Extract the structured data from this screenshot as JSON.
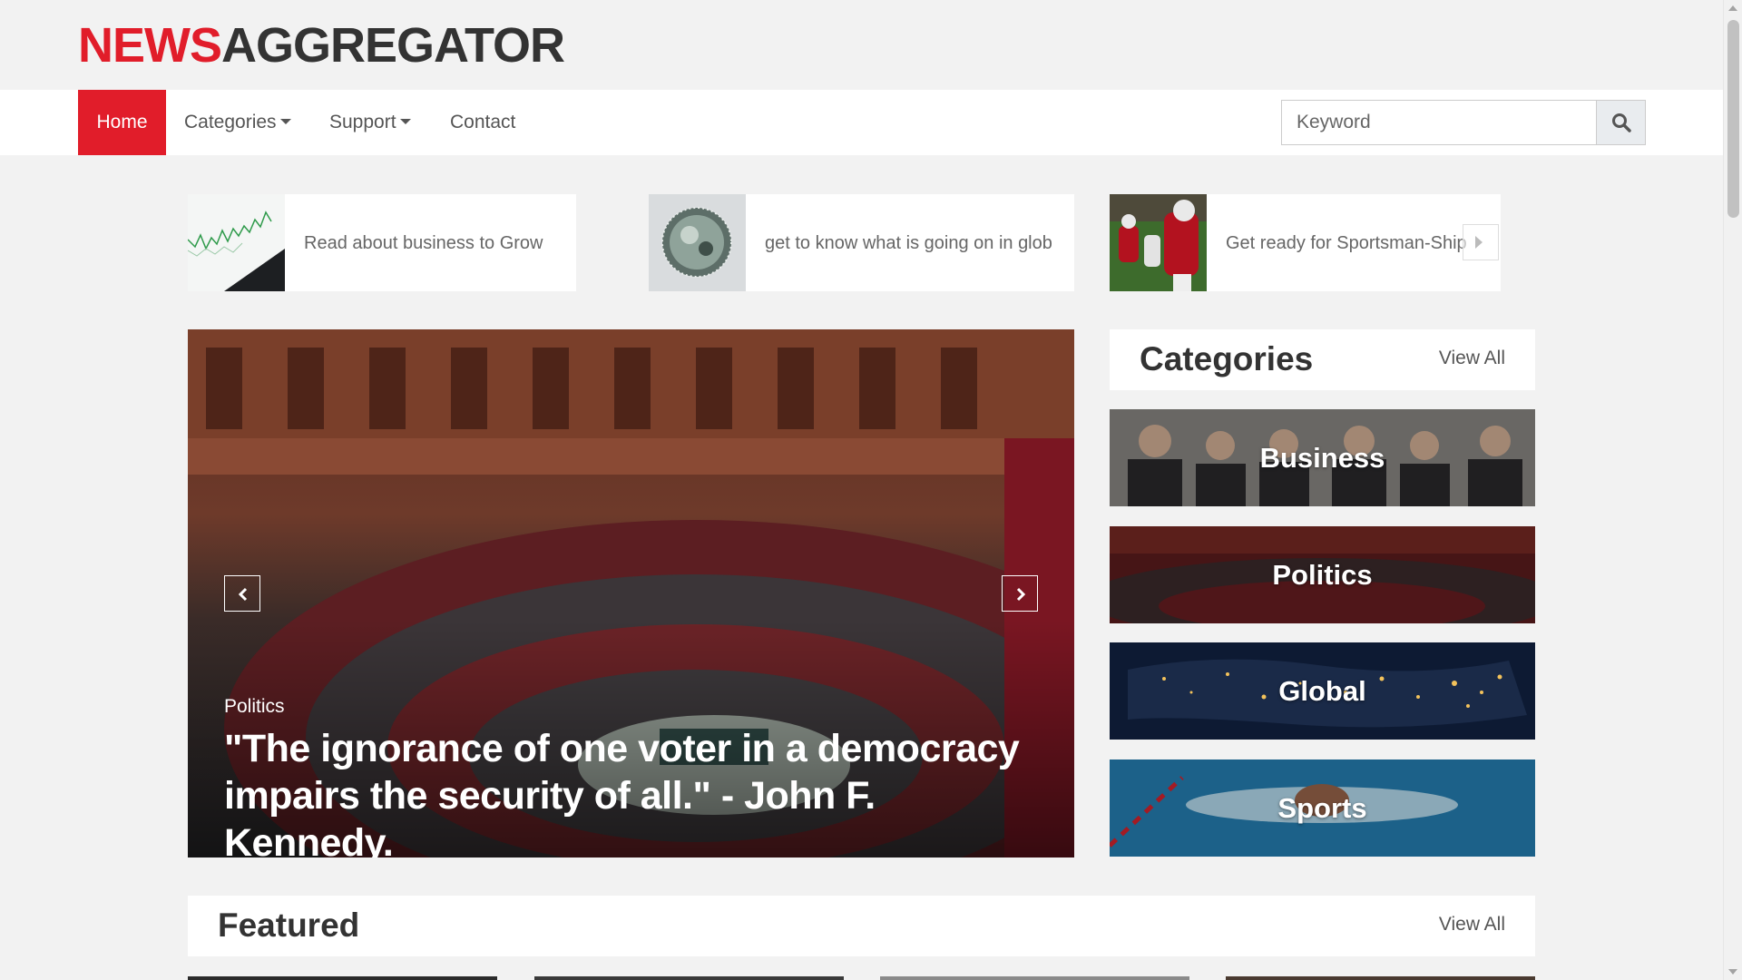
{
  "header": {
    "logo_part1": "NEWS",
    "logo_part2": "AGGREGATOR"
  },
  "nav": {
    "home": "Home",
    "categories": "Categories",
    "support": "Support",
    "contact": "Contact",
    "search_placeholder": "Keyword"
  },
  "top_stories": [
    {
      "text": "Read about business to Grow"
    },
    {
      "text": "get to know what is going on in glob"
    },
    {
      "text": "Get ready for Sportsman-Ship"
    }
  ],
  "hero": {
    "category": "Politics",
    "title": "\"The ignorance of one voter in a democracy impairs the security of all.\" - John F. Kennedy."
  },
  "categories_widget": {
    "title": "Categories",
    "view_all": "View All",
    "items": [
      {
        "label": "Business"
      },
      {
        "label": "Politics"
      },
      {
        "label": "Global"
      },
      {
        "label": "Sports"
      }
    ]
  },
  "featured": {
    "title": "Featured",
    "view_all": "View All"
  },
  "colors": {
    "brand_red": "#e11d2a",
    "page_bg": "#f2f2f2"
  }
}
